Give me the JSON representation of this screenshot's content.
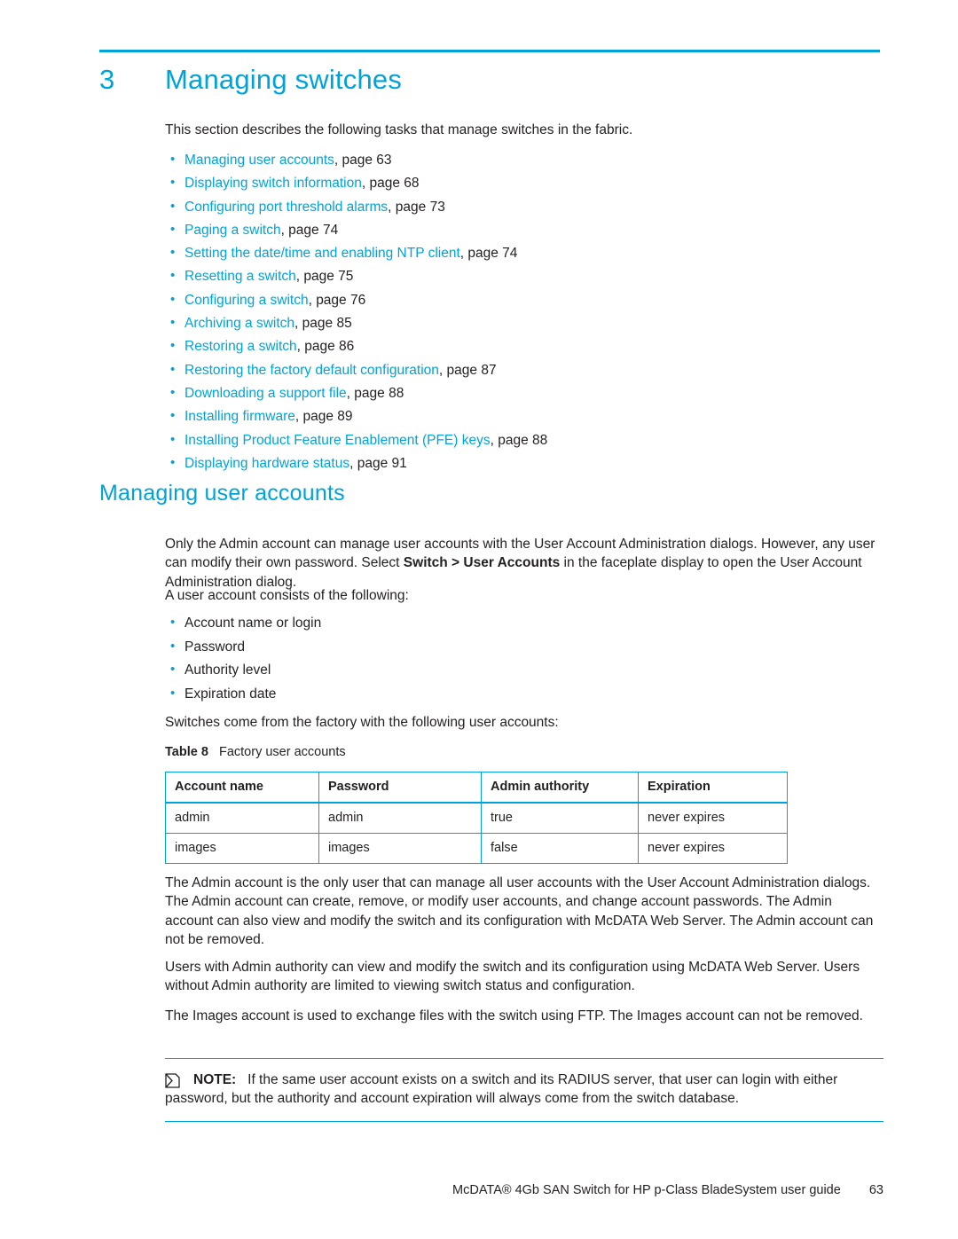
{
  "chapter": {
    "number": "3",
    "title": "Managing switches"
  },
  "intro": "This section describes the following tasks that manage switches in the fabric.",
  "xref_items": [
    {
      "link": "Managing user accounts",
      "tail": ", page 63"
    },
    {
      "link": "Displaying switch information",
      "tail": ", page 68"
    },
    {
      "link": "Configuring port threshold alarms",
      "tail": ", page 73"
    },
    {
      "link": "Paging a switch",
      "tail": ", page 74"
    },
    {
      "link": "Setting the date/time and enabling NTP client",
      "tail": ", page 74"
    },
    {
      "link": "Resetting a switch",
      "tail": ", page 75"
    },
    {
      "link": "Configuring a switch",
      "tail": ", page 76"
    },
    {
      "link": "Archiving a switch",
      "tail": ", page 85"
    },
    {
      "link": "Restoring a switch",
      "tail": ", page 86"
    },
    {
      "link": "Restoring the factory default configuration",
      "tail": ", page 87"
    },
    {
      "link": "Downloading a support file",
      "tail": ", page 88"
    },
    {
      "link": "Installing firmware",
      "tail": ", page 89"
    },
    {
      "link": "Installing Product Feature Enablement (PFE) keys",
      "tail": ", page 88"
    },
    {
      "link": "Displaying hardware status",
      "tail": ", page 91"
    }
  ],
  "section_heading": "Managing user accounts",
  "paragraphs": {
    "p1_part1": "Only the Admin account can manage user accounts with the User Account Administration dialogs. However, any user can modify their own password. Select ",
    "p1_bold": "Switch > User Accounts",
    "p1_part2": " in the faceplate display to open the User Account Administration dialog.",
    "p2": "A user account consists of the following:",
    "p3": "Switches come from the factory with the following user accounts:",
    "p4": "The Admin account is the only user that can manage all user accounts with the User Account Administration dialogs. The Admin account can create, remove, or modify user accounts, and change account passwords. The Admin account can also view and modify the switch and its configuration with McDATA Web Server. The Admin account can not be removed.",
    "p5": "Users with Admin authority can view and modify the switch and its configuration using McDATA Web Server. Users without Admin authority are limited to viewing switch status and configuration.",
    "p6": "The Images account is used to exchange files with the switch using FTP. The Images account can not be removed."
  },
  "account_bullets": [
    "Account name or login",
    "Password",
    "Authority level",
    "Expiration date"
  ],
  "table": {
    "caption_label": "Table 8",
    "caption_text": "Factory user accounts",
    "headers": [
      "Account name",
      "Password",
      "Admin authority",
      "Expiration"
    ],
    "rows": [
      [
        "admin",
        "admin",
        "true",
        "never expires"
      ],
      [
        "images",
        "images",
        "false",
        "never expires"
      ]
    ]
  },
  "note": {
    "label": "NOTE:",
    "text": "If the same user account exists on a switch and its RADIUS server, that user can login with either password, but the authority and account expiration will always come from the switch database."
  },
  "footer": {
    "text": "McDATA® 4Gb SAN Switch for HP p-Class BladeSystem user guide",
    "page": "63"
  },
  "colors": {
    "accent": "#00a3d9",
    "text": "#231f20"
  }
}
